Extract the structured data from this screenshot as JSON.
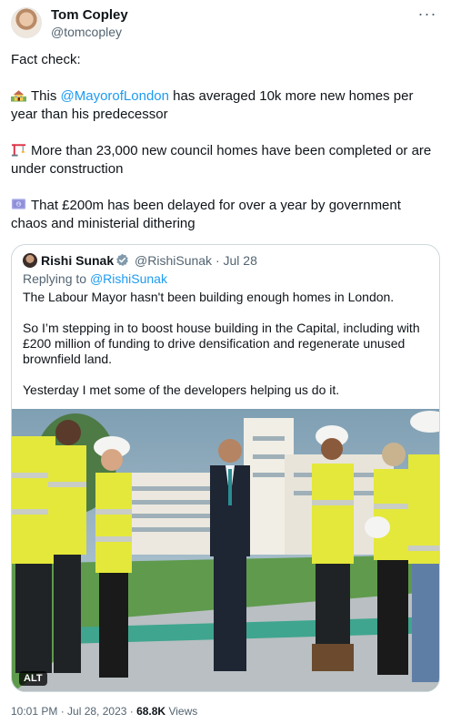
{
  "author": {
    "name": "Tom Copley",
    "handle": "@tomcopley"
  },
  "tweet": {
    "intro": "Fact check:",
    "points": [
      {
        "icon": "house-icon",
        "prefix": "This ",
        "mention": "@MayorofLondon",
        "suffix": " has averaged 10k more new homes per year than his predecessor"
      },
      {
        "icon": "crane-icon",
        "prefix": "More than 23,000 new council homes have been completed or are under construction",
        "mention": "",
        "suffix": ""
      },
      {
        "icon": "money-icon",
        "prefix": "That £200m has been delayed for over a year by government chaos and ministerial dithering",
        "mention": "",
        "suffix": ""
      }
    ]
  },
  "quote": {
    "name": "Rishi Sunak",
    "handle": "@RishiSunak",
    "separator": "·",
    "date": "Jul 28",
    "replying_prefix": "Replying to ",
    "replying_to": "@RishiSunak",
    "paragraphs": [
      "The Labour Mayor hasn't been building enough homes in London.",
      "So I’m stepping in to boost house building in the Capital, including with £200 million of funding to drive densification and regenerate unused brownfield land.",
      "Yesterday I met some of the developers helping us do it."
    ],
    "media_alt_badge": "ALT"
  },
  "meta": {
    "time": "10:01 PM · Jul 28, 2023 · ",
    "views": "68.8K",
    "views_label": " Views"
  },
  "colors": {
    "link": "#1d9bf0",
    "muted": "#536471",
    "text": "#0f1419",
    "border": "#cfd9de",
    "hi_vis": "#e4e83a"
  }
}
